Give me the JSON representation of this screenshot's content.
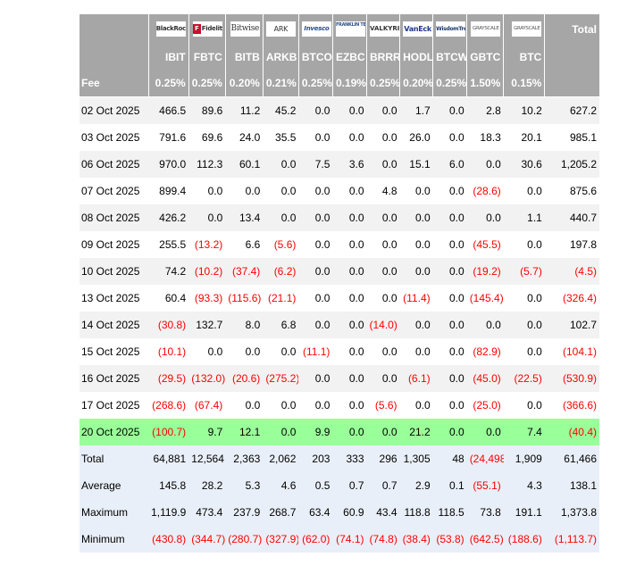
{
  "providers": [
    {
      "logo": "BlackRock",
      "ticker": "IBIT",
      "fee": "0.25%"
    },
    {
      "logo": "Fidelity",
      "ticker": "FBTC",
      "fee": "0.25%"
    },
    {
      "logo": "Bitwise",
      "ticker": "BITB",
      "fee": "0.20%"
    },
    {
      "logo": "ARK",
      "ticker": "ARKB",
      "fee": "0.21%"
    },
    {
      "logo": "Invesco",
      "ticker": "BTCO",
      "fee": "0.25%"
    },
    {
      "logo": "FRANKLIN TEMPLETON",
      "ticker": "EZBC",
      "fee": "0.19%"
    },
    {
      "logo": "VALKYRIE",
      "ticker": "BRRR",
      "fee": "0.25%"
    },
    {
      "logo": "VanEck",
      "ticker": "HODL",
      "fee": "0.20%"
    },
    {
      "logo": "WisdomTree",
      "ticker": "BTCW",
      "fee": "0.25%"
    },
    {
      "logo": "GRAYSCALE",
      "ticker": "GBTC",
      "fee": "1.50%"
    },
    {
      "logo": "GRAYSCALE",
      "ticker": "BTC",
      "fee": "0.15%"
    }
  ],
  "header": {
    "total_label": "Total",
    "fee_label": "Fee"
  },
  "rows": [
    {
      "date": "02 Oct 2025",
      "values": [
        "466.5",
        "89.6",
        "11.2",
        "45.2",
        "0.0",
        "0.0",
        "0.0",
        "1.7",
        "0.0",
        "2.8",
        "10.2",
        "627.2"
      ]
    },
    {
      "date": "03 Oct 2025",
      "values": [
        "791.6",
        "69.6",
        "24.0",
        "35.5",
        "0.0",
        "0.0",
        "0.0",
        "26.0",
        "0.0",
        "18.3",
        "20.1",
        "985.1"
      ]
    },
    {
      "date": "06 Oct 2025",
      "values": [
        "970.0",
        "112.3",
        "60.1",
        "0.0",
        "7.5",
        "3.6",
        "0.0",
        "15.1",
        "6.0",
        "0.0",
        "30.6",
        "1,205.2"
      ]
    },
    {
      "date": "07 Oct 2025",
      "values": [
        "899.4",
        "0.0",
        "0.0",
        "0.0",
        "0.0",
        "0.0",
        "4.8",
        "0.0",
        "0.0",
        "(28.6)",
        "0.0",
        "875.6"
      ]
    },
    {
      "date": "08 Oct 2025",
      "values": [
        "426.2",
        "0.0",
        "13.4",
        "0.0",
        "0.0",
        "0.0",
        "0.0",
        "0.0",
        "0.0",
        "0.0",
        "1.1",
        "440.7"
      ]
    },
    {
      "date": "09 Oct 2025",
      "values": [
        "255.5",
        "(13.2)",
        "6.6",
        "(5.6)",
        "0.0",
        "0.0",
        "0.0",
        "0.0",
        "0.0",
        "(45.5)",
        "0.0",
        "197.8"
      ]
    },
    {
      "date": "10 Oct 2025",
      "values": [
        "74.2",
        "(10.2)",
        "(37.4)",
        "(6.2)",
        "0.0",
        "0.0",
        "0.0",
        "0.0",
        "0.0",
        "(19.2)",
        "(5.7)",
        "(4.5)"
      ]
    },
    {
      "date": "13 Oct 2025",
      "values": [
        "60.4",
        "(93.3)",
        "(115.6)",
        "(21.1)",
        "0.0",
        "0.0",
        "0.0",
        "(11.4)",
        "0.0",
        "(145.4)",
        "0.0",
        "(326.4)"
      ]
    },
    {
      "date": "14 Oct 2025",
      "values": [
        "(30.8)",
        "132.7",
        "8.0",
        "6.8",
        "0.0",
        "0.0",
        "(14.0)",
        "0.0",
        "0.0",
        "0.0",
        "0.0",
        "102.7"
      ]
    },
    {
      "date": "15 Oct 2025",
      "values": [
        "(10.1)",
        "0.0",
        "0.0",
        "0.0",
        "(11.1)",
        "0.0",
        "0.0",
        "0.0",
        "0.0",
        "(82.9)",
        "0.0",
        "(104.1)"
      ]
    },
    {
      "date": "16 Oct 2025",
      "values": [
        "(29.5)",
        "(132.0)",
        "(20.6)",
        "(275.2)",
        "0.0",
        "0.0",
        "0.0",
        "(6.1)",
        "0.0",
        "(45.0)",
        "(22.5)",
        "(530.9)"
      ]
    },
    {
      "date": "17 Oct 2025",
      "values": [
        "(268.6)",
        "(67.4)",
        "0.0",
        "0.0",
        "0.0",
        "0.0",
        "(5.6)",
        "0.0",
        "0.0",
        "(25.0)",
        "0.0",
        "(366.6)"
      ]
    },
    {
      "date": "20 Oct 2025",
      "values": [
        "(100.7)",
        "9.7",
        "12.1",
        "0.0",
        "9.9",
        "0.0",
        "0.0",
        "21.2",
        "0.0",
        "0.0",
        "7.4",
        "(40.4)"
      ],
      "highlight": true
    }
  ],
  "stats": [
    {
      "label": "Total",
      "values": [
        "64,881",
        "12,564",
        "2,363",
        "2,062",
        "203",
        "333",
        "296",
        "1,305",
        "48",
        "(24,498)",
        "1,909",
        "61,466"
      ]
    },
    {
      "label": "Average",
      "values": [
        "145.8",
        "28.2",
        "5.3",
        "4.6",
        "0.5",
        "0.7",
        "0.7",
        "2.9",
        "0.1",
        "(55.1)",
        "4.3",
        "138.1"
      ]
    },
    {
      "label": "Maximum",
      "values": [
        "1,119.9",
        "473.4",
        "237.9",
        "268.7",
        "63.4",
        "60.9",
        "43.4",
        "118.8",
        "118.5",
        "73.8",
        "191.1",
        "1,373.8"
      ]
    },
    {
      "label": "Minimum",
      "values": [
        "(430.8)",
        "(344.7)",
        "(280.7)",
        "(327.9)",
        "(62.0)",
        "(74.1)",
        "(74.8)",
        "(38.4)",
        "(53.8)",
        "(642.5)",
        "(188.6)",
        "(1,113.7)"
      ]
    }
  ],
  "colors": {
    "header_bg": "#a6a6a6",
    "negative": "#ff0000",
    "highlight_row": "#99ff99",
    "stats_bg": "#e9eff8",
    "stripe_bg": "#f2f2f2"
  }
}
